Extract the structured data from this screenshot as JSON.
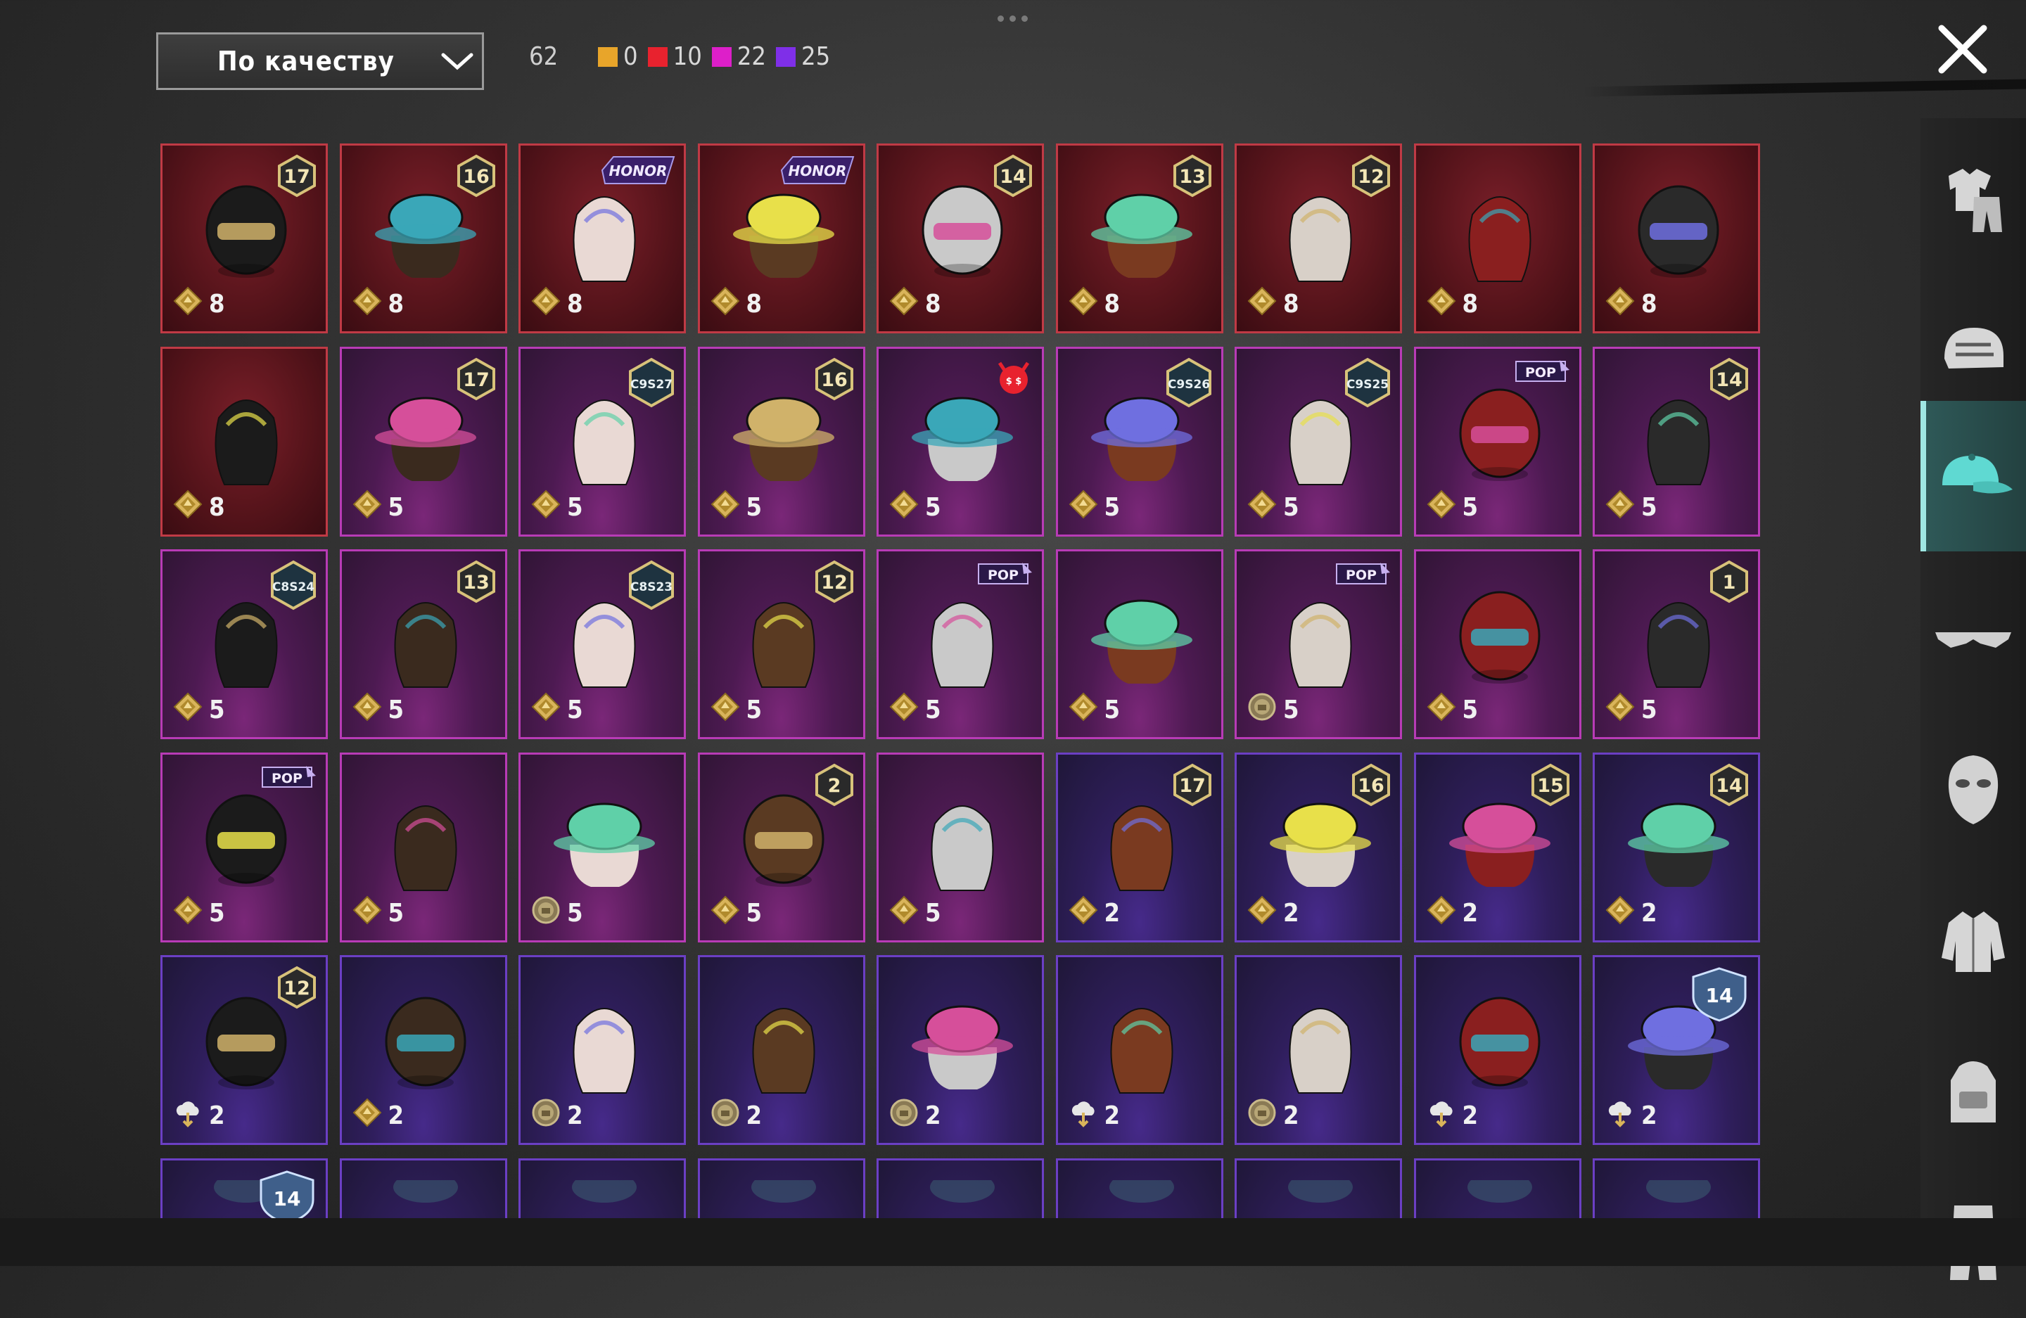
{
  "header": {
    "sort_label": "По качеству",
    "total": "62",
    "counts": [
      {
        "value": "0",
        "color": "#e8a52a"
      },
      {
        "value": "10",
        "color": "#e8222e"
      },
      {
        "value": "22",
        "color": "#dd1fc9"
      },
      {
        "value": "25",
        "color": "#7f2fe8"
      }
    ]
  },
  "colors": {
    "red_tier": "#c03a45",
    "pink_tier": "#b83bb6",
    "purple_tier": "#6b3fc4",
    "active_tab": "#2f5a59"
  },
  "sidebar": {
    "categories": [
      {
        "icon": "outfit-icon",
        "active": false
      },
      {
        "icon": "helmet-icon",
        "active": false
      },
      {
        "icon": "cap-icon",
        "active": true
      },
      {
        "icon": "glasses-icon",
        "active": false
      },
      {
        "icon": "mask-icon",
        "active": false
      },
      {
        "icon": "jacket-icon",
        "active": false
      },
      {
        "icon": "backpack-icon",
        "active": false
      },
      {
        "icon": "pants-icon",
        "active": false
      }
    ]
  },
  "items": [
    {
      "tier": "red",
      "price": "8",
      "currency": "coupon",
      "badge": "17",
      "item": "tribal-mask-hair"
    },
    {
      "tier": "red",
      "price": "8",
      "currency": "coupon",
      "badge": "16",
      "item": "goggles-cap-hair"
    },
    {
      "tier": "red",
      "price": "8",
      "currency": "coupon",
      "badge": "HONOR",
      "item": "long-white-hair"
    },
    {
      "tier": "red",
      "price": "8",
      "currency": "coupon",
      "badge": "HONOR",
      "item": "top-hat"
    },
    {
      "tier": "red",
      "price": "8",
      "currency": "coupon",
      "badge": "14",
      "item": "horse-mask"
    },
    {
      "tier": "red",
      "price": "8",
      "currency": "coupon",
      "badge": "13",
      "item": "feather-hat-hair"
    },
    {
      "tier": "red",
      "price": "8",
      "currency": "coupon",
      "badge": "12",
      "item": "white-curly-hair"
    },
    {
      "tier": "red",
      "price": "8",
      "currency": "coupon",
      "badge": "",
      "item": "red-spiky-hair"
    },
    {
      "tier": "red",
      "price": "8",
      "currency": "coupon",
      "badge": "",
      "item": "black-helmet"
    },
    {
      "tier": "red",
      "price": "8",
      "currency": "coupon",
      "badge": "",
      "item": "snowman-head"
    },
    {
      "tier": "pink",
      "price": "5",
      "currency": "coupon",
      "badge": "17",
      "item": "teal-cap-hair"
    },
    {
      "tier": "pink",
      "price": "5",
      "currency": "coupon",
      "badge": "C9S27",
      "item": "bunny-headphones"
    },
    {
      "tier": "pink",
      "price": "5",
      "currency": "coupon",
      "badge": "16",
      "item": "dark-cap-hair"
    },
    {
      "tier": "pink",
      "price": "5",
      "currency": "coupon",
      "badge": "DEVIL",
      "item": "yellow-ushanka"
    },
    {
      "tier": "pink",
      "price": "5",
      "currency": "coupon",
      "badge": "C9S26",
      "item": "snail-hat"
    },
    {
      "tier": "pink",
      "price": "5",
      "currency": "coupon",
      "badge": "C9S25",
      "item": "grey-hair-bow"
    },
    {
      "tier": "pink",
      "price": "5",
      "currency": "coupon",
      "badge": "POP",
      "item": "yellow-box-head"
    },
    {
      "tier": "pink",
      "price": "5",
      "currency": "coupon",
      "badge": "14",
      "item": "flower-hair"
    },
    {
      "tier": "pink",
      "price": "5",
      "currency": "coupon",
      "badge": "C8S24",
      "item": "black-bob-hair"
    },
    {
      "tier": "pink",
      "price": "5",
      "currency": "coupon",
      "badge": "13",
      "item": "aviator-goggles"
    },
    {
      "tier": "pink",
      "price": "5",
      "currency": "coupon",
      "badge": "C8S23",
      "item": "cat-headphones"
    },
    {
      "tier": "pink",
      "price": "5",
      "currency": "coupon",
      "badge": "12",
      "item": "orange-twin-tails"
    },
    {
      "tier": "pink",
      "price": "5",
      "currency": "coupon",
      "badge": "POP",
      "item": "silver-long-hair"
    },
    {
      "tier": "pink",
      "price": "5",
      "currency": "coupon",
      "badge": "",
      "item": "blue-dragon-hat"
    },
    {
      "tier": "pink",
      "price": "5",
      "currency": "silver",
      "badge": "POP",
      "item": "braided-hair"
    },
    {
      "tier": "pink",
      "price": "5",
      "currency": "coupon",
      "badge": "",
      "item": "blue-bat-helmet"
    },
    {
      "tier": "pink",
      "price": "5",
      "currency": "coupon",
      "badge": "1",
      "item": "pastel-ponytail"
    },
    {
      "tier": "pink",
      "price": "5",
      "currency": "coupon",
      "badge": "POP",
      "item": "rabbit-mask"
    },
    {
      "tier": "pink",
      "price": "5",
      "currency": "coupon",
      "badge": "",
      "item": "afro-headphones"
    },
    {
      "tier": "pink",
      "price": "5",
      "currency": "silver",
      "badge": "",
      "item": "pink-bonnet"
    },
    {
      "tier": "pink",
      "price": "5",
      "currency": "coupon",
      "badge": "2",
      "item": "spider-helmet"
    },
    {
      "tier": "pink",
      "price": "5",
      "currency": "coupon",
      "badge": "",
      "item": "small-ears"
    },
    {
      "tier": "purple",
      "price": "2",
      "currency": "coupon",
      "badge": "17",
      "item": "spiked-visor-hair"
    },
    {
      "tier": "purple",
      "price": "2",
      "currency": "coupon",
      "badge": "16",
      "item": "beanie-goggles"
    },
    {
      "tier": "purple",
      "price": "2",
      "currency": "coupon",
      "badge": "15",
      "item": "pumpkin-beanie"
    },
    {
      "tier": "purple",
      "price": "2",
      "currency": "coupon",
      "badge": "14",
      "item": "cat-ear-cap"
    },
    {
      "tier": "purple",
      "price": "2",
      "currency": "cloud",
      "badge": "12",
      "item": "bunny-helmet"
    },
    {
      "tier": "purple",
      "price": "2",
      "currency": "coupon",
      "badge": "",
      "item": "gas-mask-helmet"
    },
    {
      "tier": "purple",
      "price": "2",
      "currency": "silver",
      "badge": "",
      "item": "goggles-hair"
    },
    {
      "tier": "purple",
      "price": "2",
      "currency": "silver",
      "badge": "",
      "item": "blonde-messy-hair"
    },
    {
      "tier": "purple",
      "price": "2",
      "currency": "silver",
      "badge": "",
      "item": "sun-hat"
    },
    {
      "tier": "purple",
      "price": "2",
      "currency": "cloud",
      "badge": "",
      "item": "red-horns"
    },
    {
      "tier": "purple",
      "price": "2",
      "currency": "silver",
      "badge": "",
      "item": "red-mohawk"
    },
    {
      "tier": "purple",
      "price": "2",
      "currency": "cloud",
      "badge": "",
      "item": "ponytail-helmet"
    },
    {
      "tier": "purple",
      "price": "2",
      "currency": "cloud",
      "badge": "S14",
      "item": "police-cap"
    },
    {
      "tier": "purple",
      "price": "",
      "currency": "",
      "badge": "S14",
      "item": "partial"
    },
    {
      "tier": "purple",
      "price": "",
      "currency": "",
      "badge": "",
      "item": "partial"
    },
    {
      "tier": "purple",
      "price": "",
      "currency": "",
      "badge": "",
      "item": "partial"
    },
    {
      "tier": "purple",
      "price": "",
      "currency": "",
      "badge": "",
      "item": "partial"
    },
    {
      "tier": "purple",
      "price": "",
      "currency": "",
      "badge": "",
      "item": "partial"
    },
    {
      "tier": "purple",
      "price": "",
      "currency": "",
      "badge": "",
      "item": "partial"
    },
    {
      "tier": "purple",
      "price": "",
      "currency": "",
      "badge": "",
      "item": "partial"
    },
    {
      "tier": "purple",
      "price": "",
      "currency": "",
      "badge": "",
      "item": "partial"
    },
    {
      "tier": "purple",
      "price": "",
      "currency": "",
      "badge": "",
      "item": "partial"
    }
  ]
}
